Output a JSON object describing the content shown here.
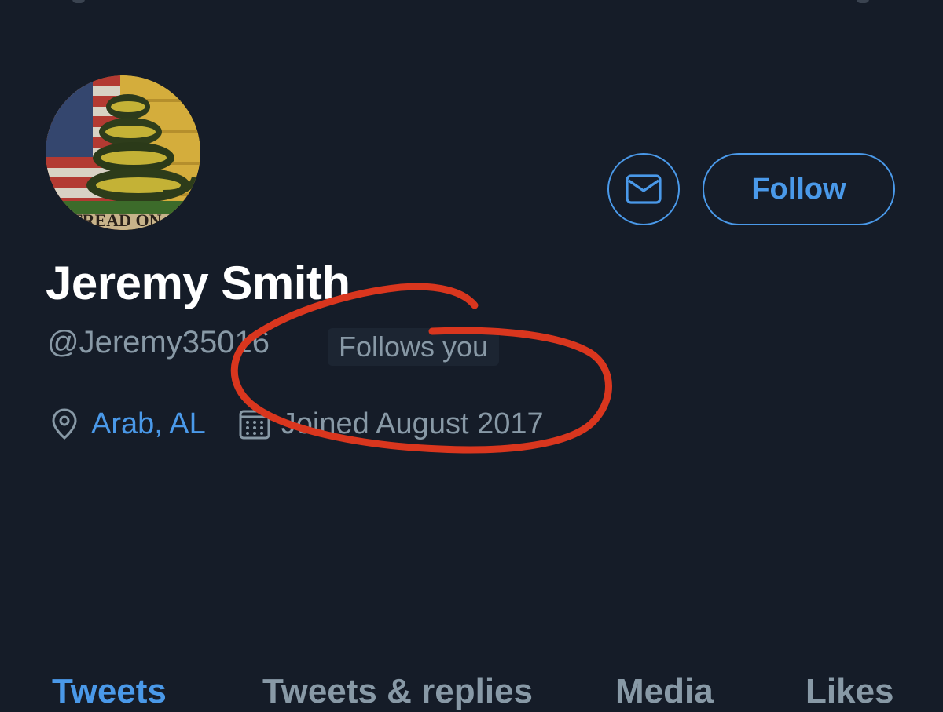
{
  "profile": {
    "avatar_text": "TREAD ON",
    "display_name": "Jeremy Smith",
    "handle": "@Jeremy35016",
    "follows_badge": "Follows you",
    "location": "Arab, AL",
    "joined": "Joined August 2017"
  },
  "actions": {
    "message_icon": "envelope-icon",
    "follow_label": "Follow"
  },
  "tabs": [
    {
      "label": "Tweets",
      "active": true
    },
    {
      "label": "Tweets & replies",
      "active": false
    },
    {
      "label": "Media",
      "active": false
    },
    {
      "label": "Likes",
      "active": false
    }
  ],
  "icons": {
    "location": "location-pin-icon",
    "joined": "calendar-icon"
  },
  "colors": {
    "background": "#151c28",
    "accent": "#4a99e9",
    "secondary_text": "#8899a6",
    "annotation": "#d9361e"
  }
}
